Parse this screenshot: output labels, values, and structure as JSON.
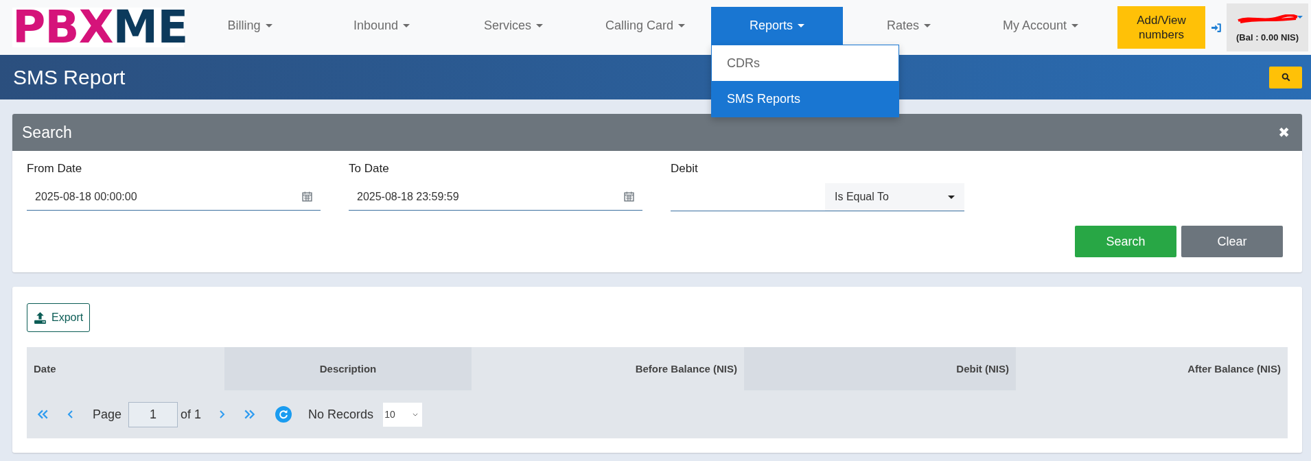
{
  "logo": {
    "primary": "PBX",
    "secondary": "ME"
  },
  "nav": [
    {
      "label": "Billing",
      "selected": false
    },
    {
      "label": "Inbound",
      "selected": false
    },
    {
      "label": "Services",
      "selected": false
    },
    {
      "label": "Calling Card",
      "selected": false
    },
    {
      "label": "Reports",
      "selected": true,
      "children": [
        {
          "label": "CDRs",
          "selected": false
        },
        {
          "label": "SMS Reports",
          "selected": true
        }
      ]
    },
    {
      "label": "Rates",
      "selected": false
    },
    {
      "label": "My Account",
      "selected": false
    }
  ],
  "add_numbers_button": "Add/View numbers",
  "account": {
    "balance": "(Bal : 0.00 NIS)"
  },
  "page_title": "SMS Report",
  "search_panel": {
    "title": "Search",
    "close": "✖",
    "fields": [
      {
        "kind": "date",
        "label": "From Date",
        "value": "2025-08-18 00:00:00"
      },
      {
        "kind": "date",
        "label": "To Date",
        "value": "2025-08-18 23:59:59"
      },
      {
        "kind": "amount",
        "label": "Debit",
        "operator": "Is Equal To"
      }
    ],
    "buttons": [
      {
        "kind": "primary",
        "label": "Search"
      },
      {
        "kind": "secondary",
        "label": "Clear"
      }
    ]
  },
  "results": {
    "export_button": "Export",
    "columns": [
      "Date",
      "Description",
      "Before Balance (NIS)",
      "Debit (NIS)",
      "After Balance (NIS)"
    ],
    "pager": {
      "page_label": "Page",
      "page": "1",
      "of": "of 1",
      "status": "No Records",
      "page_size": "10"
    }
  }
}
